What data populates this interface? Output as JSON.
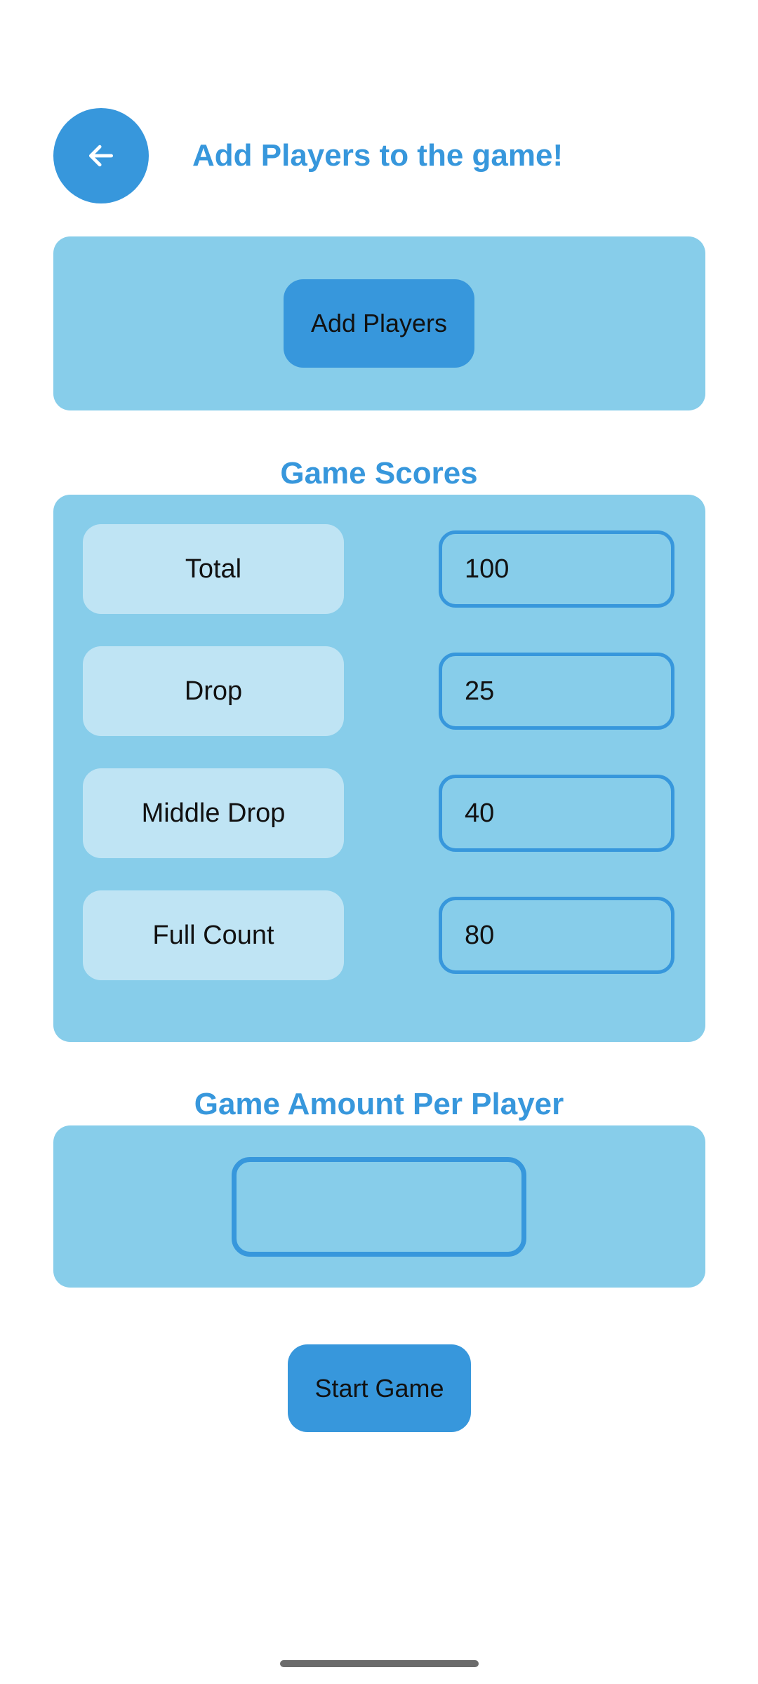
{
  "header": {
    "back_icon": "arrow-left-icon",
    "title": "Add Players to the game!"
  },
  "add_players": {
    "button_label": "Add Players"
  },
  "game_scores": {
    "heading": "Game Scores",
    "rows": [
      {
        "label": "Total",
        "value": "100"
      },
      {
        "label": "Drop",
        "value": "25"
      },
      {
        "label": "Middle Drop",
        "value": "40"
      },
      {
        "label": "Full Count",
        "value": "80"
      }
    ]
  },
  "game_amount": {
    "heading": "Game Amount Per Player",
    "value": ""
  },
  "start_game": {
    "button_label": "Start Game"
  },
  "colors": {
    "accent": "#3797dc",
    "panel": "#87cdea",
    "label_background": "#bfe4f4",
    "page_background": "#ffffff"
  }
}
